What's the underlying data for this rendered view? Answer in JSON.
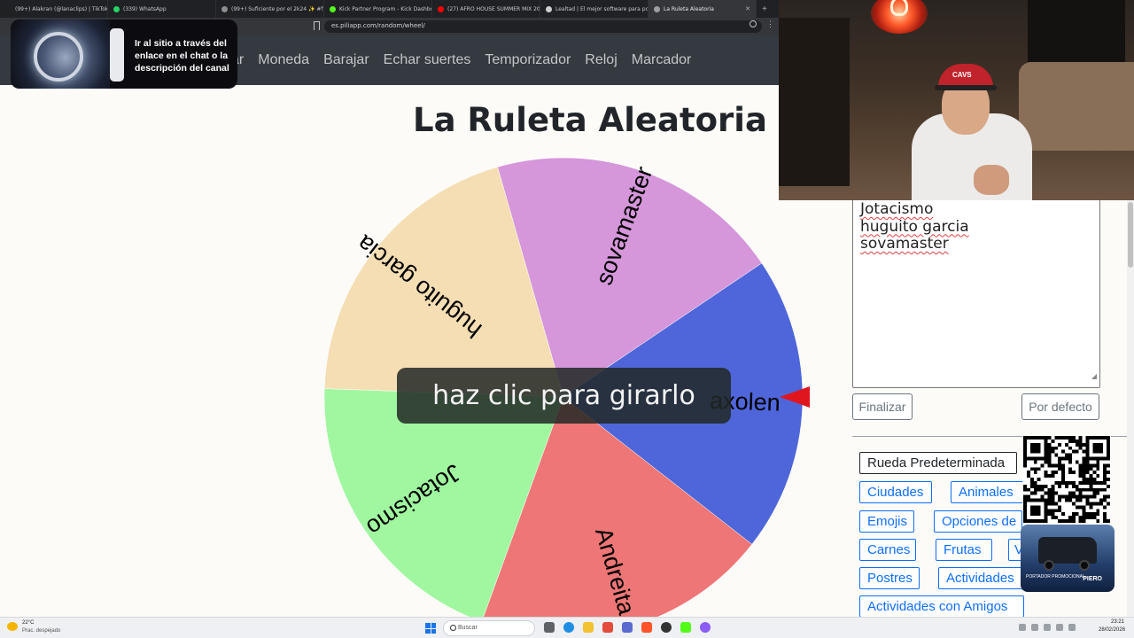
{
  "browser": {
    "tabs": [
      {
        "label": "(99+) Alakran (@lanaclips) | TikTok",
        "fav": "#222222",
        "active": false
      },
      {
        "label": "(339) WhatsApp",
        "fav": "#25d366",
        "active": false
      },
      {
        "label": "(99+) Suficiente por el 2k24 ✨ #friends",
        "fav": "#8e8e8e",
        "active": false
      },
      {
        "label": "Kick Partner Program - Kick Dashboard",
        "fav": "#53fc18",
        "active": false
      },
      {
        "label": "(27) AFRO HOUSE SUMMER MIX 2024",
        "fav": "#ff0000",
        "active": false
      },
      {
        "label": "Lealtad | El mejor software para potenciar",
        "fav": "#cfcfcf",
        "active": false
      },
      {
        "label": "La Ruleta Aleatoria",
        "fav": "#9aa0a6",
        "active": true
      }
    ],
    "url": "es.piliapp.com/random/wheel/"
  },
  "site": {
    "nav": [
      "zar",
      "Moneda",
      "Barajar",
      "Echar suertes",
      "Temporizador",
      "Reloj",
      "Marcador"
    ],
    "title": "La Ruleta Aleatoria"
  },
  "promo": {
    "text": "Ir al sitio a través del enlace en el chat o la descripción del canal"
  },
  "wheel": {
    "spin_label": "haz clic para girarlo",
    "pointer_color": "#e0161f",
    "segments": [
      {
        "label": "sovamaster",
        "color": "#d596da"
      },
      {
        "label": "axolen",
        "color": "#4e66d9"
      },
      {
        "label": "Andreita",
        "color": "#ef7676"
      },
      {
        "label": "Jotacismo",
        "color": "#a0f7a0"
      },
      {
        "label": "huguito garcia",
        "color": "#f5deb3"
      }
    ]
  },
  "panel": {
    "entries": [
      "Jotacismo",
      "huguito garcia",
      "sovamaster"
    ],
    "finish_label": "Finalizar",
    "default_label": "Por defecto",
    "presets": {
      "default_wheel": "Rueda Predeterminada",
      "cities": "Ciudades",
      "animals": "Animales",
      "emojis": "Emojis",
      "options": "Opciones de",
      "meats": "Carnes",
      "fruits": "Frutas",
      "v_item": "V",
      "desserts": "Postres",
      "activities": "Actividades",
      "friend_activities": "Actividades con Amigos"
    }
  },
  "overlay": {
    "cam_cap": "CAVS",
    "ad_left": "PORTADOR PROMOCIONAL",
    "ad_right": "PIERO"
  },
  "taskbar": {
    "temp": "22°C",
    "weather": "Prac. despejado",
    "search": "Buscar",
    "time": "23:21",
    "date": "28/02/2026"
  }
}
